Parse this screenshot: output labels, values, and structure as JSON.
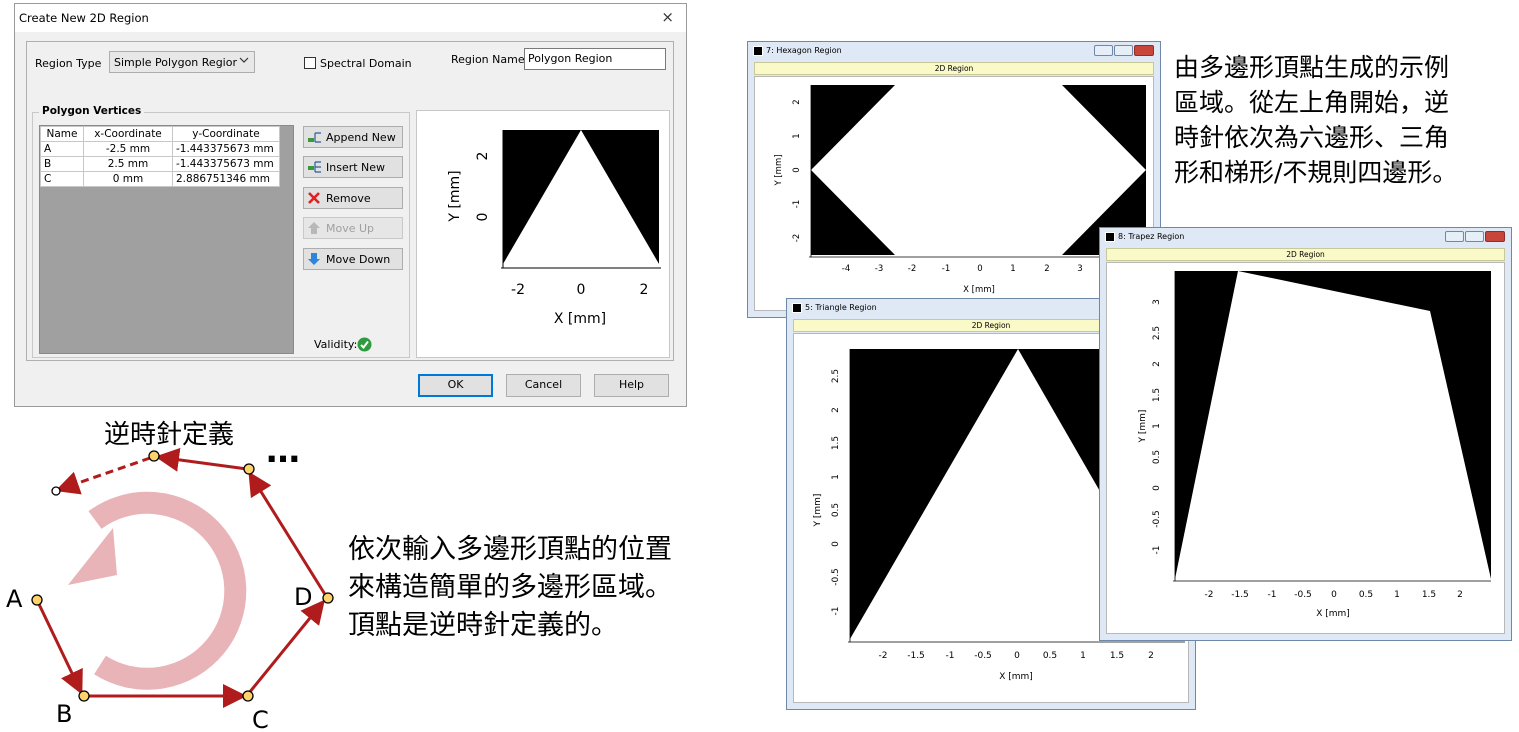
{
  "dialog": {
    "title": "Create New 2D Region",
    "close_glyph": "×",
    "region_type_label": "Region Type",
    "region_type_value": "Simple Polygon Regior",
    "spectral_domain_label": "Spectral Domain",
    "region_name_label": "Region Name",
    "region_name_value": "Polygon Region",
    "polygon_vertices_label": "Polygon Vertices",
    "table_headers": [
      "Name",
      "x-Coordinate",
      "y-Coordinate"
    ],
    "rows": [
      {
        "name": "A",
        "x": "-2.5 mm",
        "y": "-1.443375673 mm"
      },
      {
        "name": "B",
        "x": "2.5 mm",
        "y": "-1.443375673 mm"
      },
      {
        "name": "C",
        "x": "0 mm",
        "y": "2.886751346 mm"
      }
    ],
    "buttons": {
      "append": "Append New",
      "insert": "Insert New",
      "remove": "Remove",
      "move_up": "Move Up",
      "move_down": "Move Down"
    },
    "validity_label": "Validity:",
    "ok": "OK",
    "cancel": "Cancel",
    "help": "Help",
    "preview": {
      "x_label": "X [mm]",
      "y_label": "Y [mm]",
      "x_ticks": [
        "-2",
        "0",
        "2"
      ],
      "y_ticks": [
        "2",
        "0"
      ]
    }
  },
  "diagram": {
    "title": "逆時針定義",
    "ellipsis": "…",
    "points": {
      "A": "A",
      "B": "B",
      "C": "C",
      "D": "D"
    },
    "arrow_color": "#b01c1c",
    "circle_color": "#e8b4b8"
  },
  "captions": {
    "bottom": "依次輸入多邊形頂點的位置\n來構造簡單的多邊形區域。\n頂點是逆時針定義的。",
    "top_right": "由多邊形頂點生成的示例\n區域。從左上角開始，逆\n時針依次為六邊形、三角\n形和梯形/不規則四邊形。"
  },
  "windows": {
    "hexagon": {
      "title": "7: Hexagon Region",
      "strip": "2D Region",
      "x_label": "X [mm]",
      "y_label": "Y [mm]",
      "x_ticks": [
        "-4",
        "-3",
        "-2",
        "-1",
        "0",
        "1",
        "2",
        "3"
      ],
      "y_ticks": [
        "2",
        "1",
        "0",
        "-1",
        "-2"
      ]
    },
    "triangle": {
      "title": "5: Triangle Region",
      "strip": "2D Region",
      "x_label": "X [mm]",
      "y_label": "Y [mm]",
      "x_ticks": [
        "-2",
        "-1.5",
        "-1",
        "-0.5",
        "0",
        "0.5",
        "1",
        "1.5",
        "2"
      ],
      "y_ticks": [
        "2.5",
        "2",
        "1.5",
        "1",
        "0.5",
        "0",
        "-0.5",
        "-1"
      ]
    },
    "trapez": {
      "title": "8: Trapez Region",
      "strip": "2D Region",
      "x_label": "X [mm]",
      "y_label": "Y [mm]",
      "x_ticks": [
        "-2",
        "-1.5",
        "-1",
        "-0.5",
        "0",
        "0.5",
        "1",
        "1.5",
        "2"
      ],
      "y_ticks": [
        "3",
        "2.5",
        "2",
        "1.5",
        "1",
        "0.5",
        "0",
        "-0.5",
        "-1"
      ]
    }
  }
}
